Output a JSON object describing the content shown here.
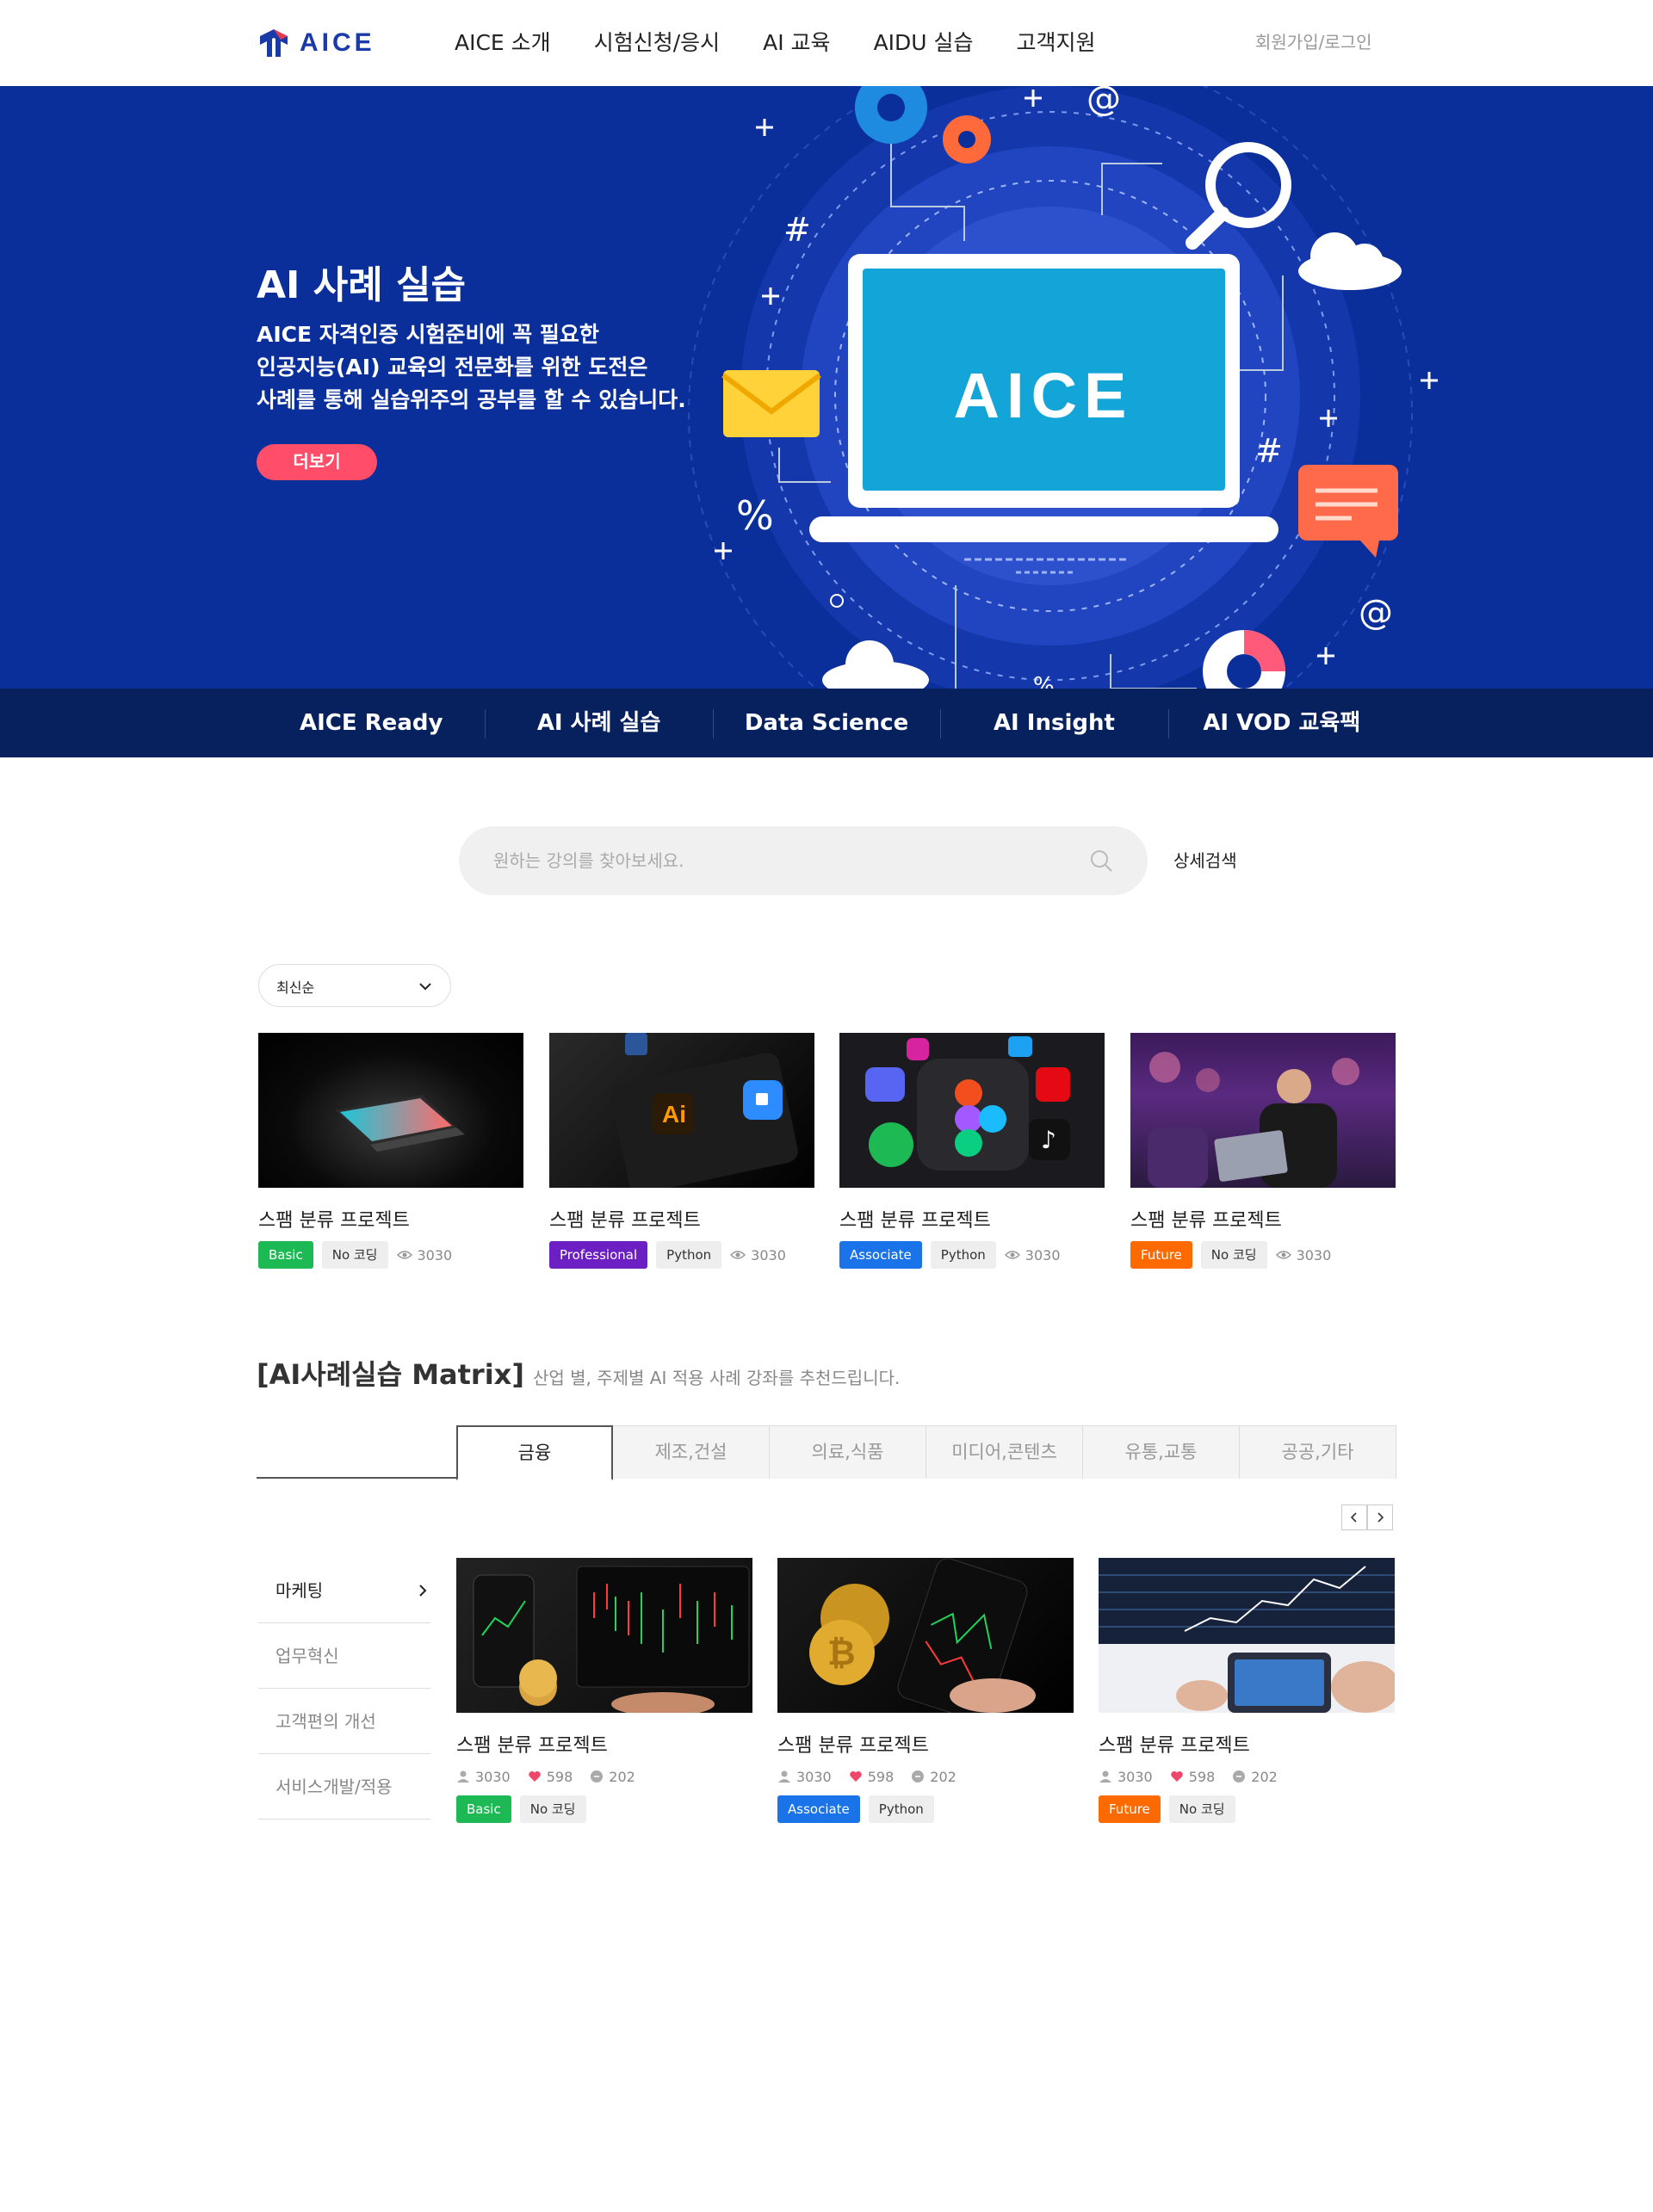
{
  "header": {
    "logo_text": "AICE",
    "nav": [
      "AICE 소개",
      "시험신청/응시",
      "AI 교육",
      "AIDU 실습",
      "고객지원"
    ],
    "login": "회원가입/로그인"
  },
  "hero": {
    "title": "AI 사례 실습",
    "desc": [
      "AICE 자격인증 시험준비에 꼭 필요한",
      "인공지능(AI) 교육의 전문화를 위한 도전은",
      "사례를 통해 실습위주의 공부를 할 수 있습니다."
    ],
    "more_label": "더보기",
    "laptop_text": "AICE",
    "symbols": [
      "#",
      "%",
      "@",
      "#",
      "@",
      "%"
    ]
  },
  "subnav": [
    "AICE Ready",
    "AI 사례 실습",
    "Data Science",
    "AI Insight",
    "AI VOD 교육팩"
  ],
  "search": {
    "placeholder": "원하는 강의를 찾아보세요.",
    "detail": "상세검색"
  },
  "sort": {
    "selected": "최신순"
  },
  "colors": {
    "basic": "#1db954",
    "professional": "#6c1fc2",
    "associate": "#1a73e8",
    "future": "#ff6a00"
  },
  "cards": [
    {
      "title": "스팸 분류 프로젝트",
      "level": "Basic",
      "tool": "No 코딩",
      "views": "3030",
      "image": "laptop-photo"
    },
    {
      "title": "스팸 분류 프로젝트",
      "level": "Professional",
      "tool": "Python",
      "views": "3030",
      "image": "apps-photo"
    },
    {
      "title": "스팸 분류 프로젝트",
      "level": "Associate",
      "tool": "Python",
      "views": "3030",
      "image": "social-icons-photo"
    },
    {
      "title": "스팸 분류 프로젝트",
      "level": "Future",
      "tool": "No 코딩",
      "views": "3030",
      "image": "conference-photo"
    }
  ],
  "matrix": {
    "title": "[AI사례실습 Matrix]",
    "subtitle": "산업 별, 주제별 AI 적용 사례 강좌를 추천드립니다.",
    "tabs": [
      "금융",
      "제조,건설",
      "의료,식품",
      "미디어,콘텐츠",
      "유통,교통",
      "공공,기타"
    ],
    "side": [
      "마케팅",
      "업무혁신",
      "고객편의 개선",
      "서비스개발/적용"
    ],
    "cards": [
      {
        "title": "스팸 분류 프로젝트",
        "users": "3030",
        "likes": "598",
        "comments": "202",
        "level": "Basic",
        "tool": "No 코딩",
        "image": "trading-laptop-photo"
      },
      {
        "title": "스팸 분류 프로젝트",
        "users": "3030",
        "likes": "598",
        "comments": "202",
        "level": "Associate",
        "tool": "Python",
        "image": "bitcoin-phone-photo"
      },
      {
        "title": "스팸 분류 프로젝트",
        "users": "3030",
        "likes": "598",
        "comments": "202",
        "level": "Future",
        "tool": "No 코딩",
        "image": "stock-chart-photo"
      }
    ]
  }
}
